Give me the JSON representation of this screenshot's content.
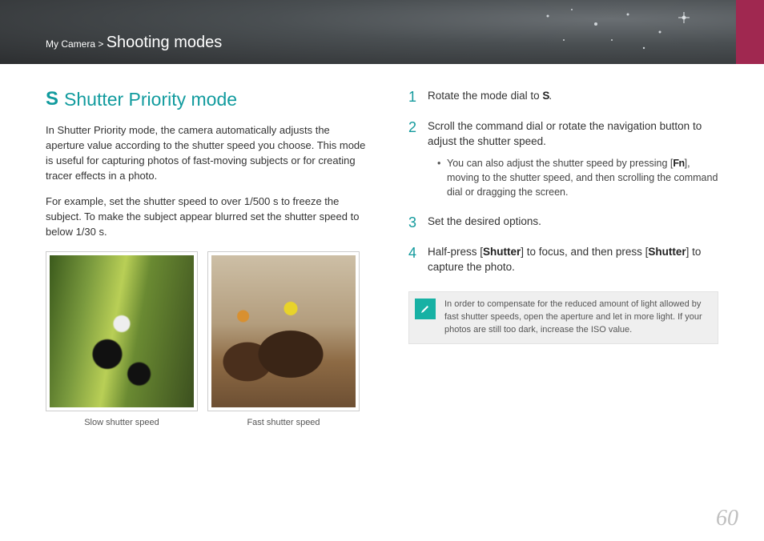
{
  "breadcrumb": {
    "root": "My Camera",
    "sep": ">",
    "section": "Shooting modes"
  },
  "left": {
    "mode_icon": "S",
    "title": "Shutter Priority mode",
    "p1": "In Shutter Priority mode, the camera automatically adjusts the aperture value according to the shutter speed you choose. This mode is useful for capturing photos of fast-moving subjects or for creating tracer effects in a photo.",
    "p2": "For example, set the shutter speed to over 1/500 s to freeze the subject. To make the subject appear blurred set the shutter speed to below 1/30 s.",
    "thumb1_caption": "Slow shutter speed",
    "thumb2_caption": "Fast shutter speed"
  },
  "steps": [
    {
      "n": "1",
      "pre": "Rotate the mode dial to ",
      "glyph": "S",
      "post": "."
    },
    {
      "n": "2",
      "text": "Scroll the command dial or rotate the navigation button to adjust the shutter speed.",
      "sub": {
        "pre": "You can also adjust the shutter speed by pressing [",
        "glyph": "Fn",
        "post": "], moving to the shutter speed, and then scrolling the command dial or dragging the screen."
      }
    },
    {
      "n": "3",
      "text": "Set the desired options."
    },
    {
      "n": "4",
      "pre": "Half-press [",
      "b1": "Shutter",
      "mid": "] to focus, and then press [",
      "b2": "Shutter",
      "post": "] to capture the photo."
    }
  ],
  "hint": "In order to compensate for the reduced amount of light allowed by fast shutter speeds, open the aperture and let in more light. If your photos are still too dark, increase the ISO value.",
  "page": "60"
}
